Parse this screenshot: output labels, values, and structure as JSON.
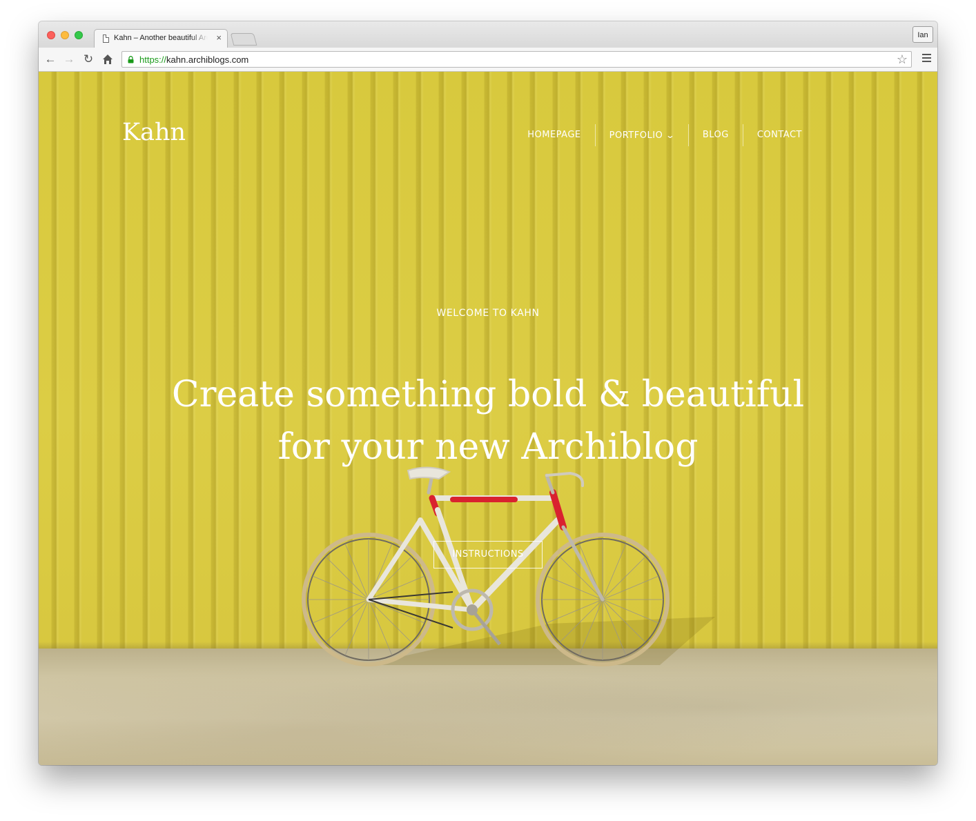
{
  "browser": {
    "tab_title": "Kahn – Another beautiful Archiblog",
    "tab_close": "×",
    "profile": "Ian",
    "url_scheme": "https://",
    "url_host": "kahn.archiblogs.com"
  },
  "site": {
    "logo": "Kahn",
    "nav": [
      {
        "label": "HOMEPAGE"
      },
      {
        "label": "PORTFOLIO",
        "has_dropdown": true
      },
      {
        "label": "BLOG"
      },
      {
        "label": "CONTACT"
      }
    ],
    "hero": {
      "kicker": "WELCOME TO KAHN",
      "headline": "Create something bold & beautiful for your new Archiblog",
      "button": "INSTRUCTIONS"
    }
  },
  "colors": {
    "wall_yellow": "#d8c93d",
    "bike_red": "#d9222f"
  },
  "icons": [
    "back-icon",
    "forward-icon",
    "reload-icon",
    "home-icon",
    "lock-icon",
    "star-icon",
    "menu-icon",
    "chevron-down-icon"
  ]
}
